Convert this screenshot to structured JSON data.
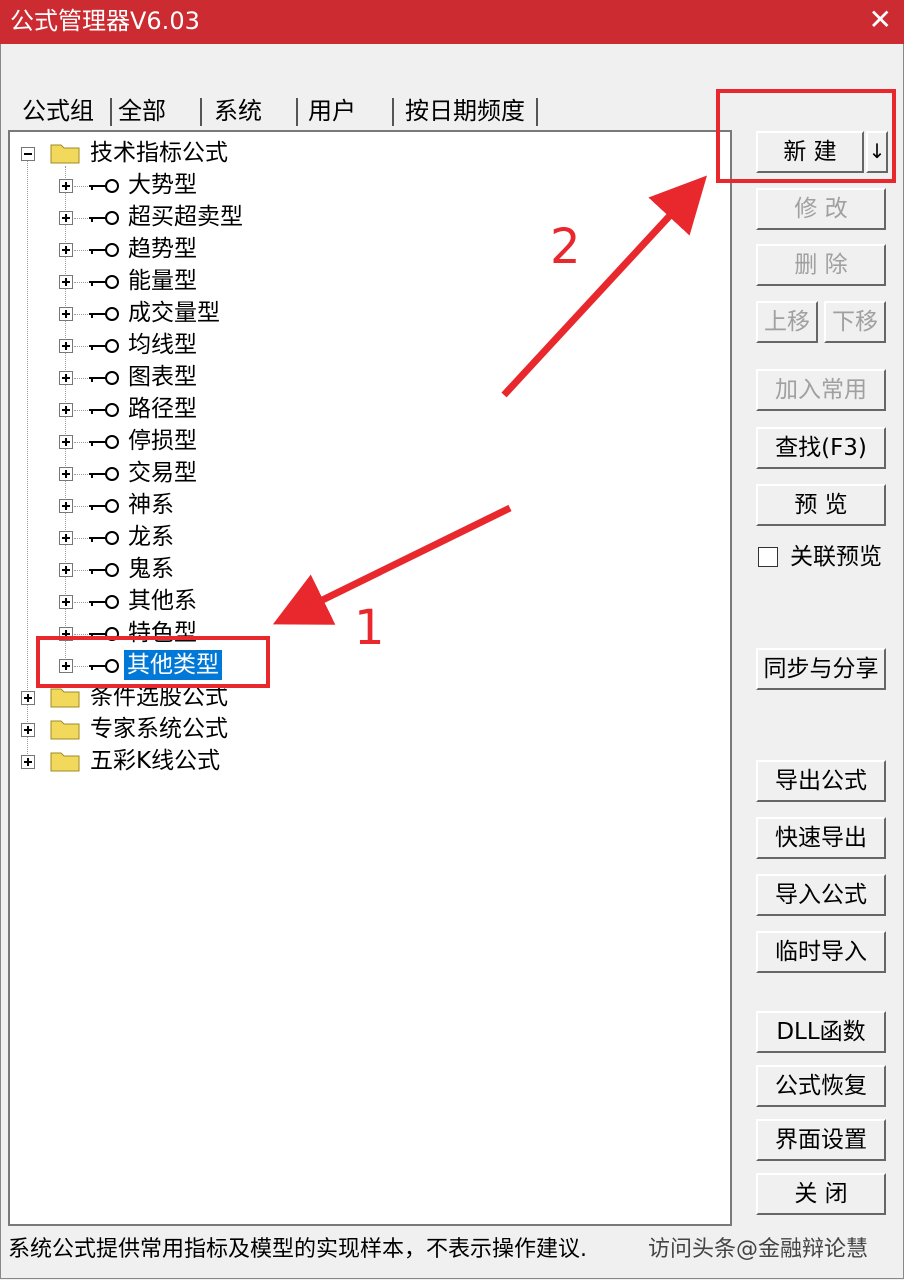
{
  "window": {
    "title": "公式管理器V6.03",
    "close_glyph": "✕",
    "accent_color": "#cc2b32"
  },
  "tabs": [
    {
      "label": "公式组"
    },
    {
      "label": "全部"
    },
    {
      "label": "系统"
    },
    {
      "label": "用户"
    },
    {
      "label": "按日期频度"
    }
  ],
  "tree": {
    "groups": [
      {
        "label": "技术指标公式",
        "expanded": true,
        "children": [
          {
            "label": "大势型"
          },
          {
            "label": "超买超卖型"
          },
          {
            "label": "趋势型"
          },
          {
            "label": "能量型"
          },
          {
            "label": "成交量型"
          },
          {
            "label": "均线型"
          },
          {
            "label": "图表型"
          },
          {
            "label": "路径型"
          },
          {
            "label": "停损型"
          },
          {
            "label": "交易型"
          },
          {
            "label": "神系"
          },
          {
            "label": "龙系"
          },
          {
            "label": "鬼系"
          },
          {
            "label": "其他系"
          },
          {
            "label": "特色型"
          },
          {
            "label": "其他类型",
            "selected": true
          }
        ]
      },
      {
        "label": "条件选股公式",
        "expanded": false
      },
      {
        "label": "专家系统公式",
        "expanded": false
      },
      {
        "label": "五彩K线公式",
        "expanded": false
      }
    ]
  },
  "buttons": {
    "new": "新 建",
    "new_dropdown": "↓",
    "modify": "修 改",
    "delete": "删 除",
    "move_up": "上移",
    "move_down": "下移",
    "add_common": "加入常用",
    "find": "查找(F3)",
    "preview": "预 览",
    "linked_preview": "关联预览",
    "sync_share": "同步与分享",
    "export": "导出公式",
    "quick_export": "快速导出",
    "import": "导入公式",
    "temp_import": "临时导入",
    "dll": "DLL函数",
    "restore": "公式恢复",
    "ui_settings": "界面设置",
    "close": "关 闭"
  },
  "status": {
    "text": "系统公式提供常用指标及模型的实现样本，不表示操作建议.",
    "watermark": "访问头条@金融辩论慧"
  },
  "annotations": {
    "num1": "1",
    "num2": "2",
    "color": "#e8282d"
  }
}
